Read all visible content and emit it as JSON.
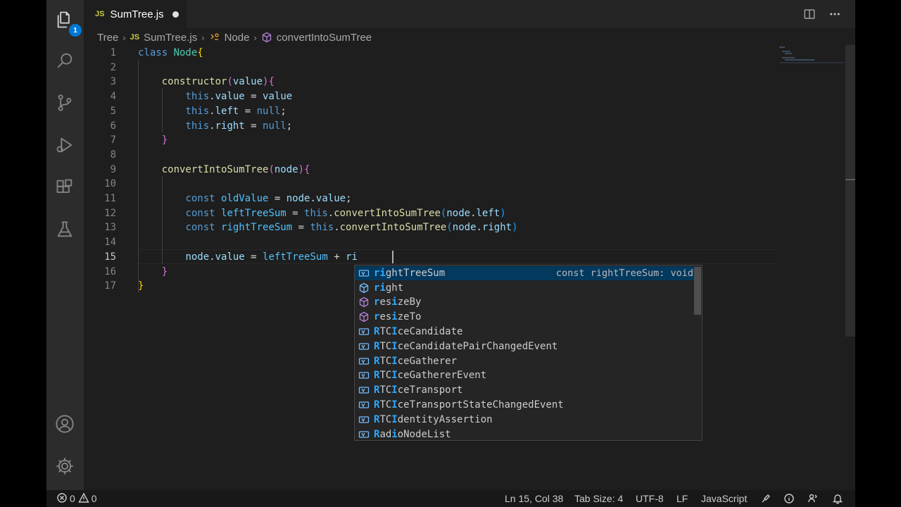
{
  "tab": {
    "title": "SumTree.js",
    "lang_badge": "JS",
    "modified": true
  },
  "breadcrumb": {
    "items": [
      "Tree",
      "SumTree.js",
      "Node",
      "convertIntoSumTree"
    ]
  },
  "activity_bar": {
    "items": [
      "explorer",
      "search",
      "source-control",
      "run-and-debug",
      "extensions",
      "testing"
    ],
    "explorer_badge": "1",
    "bottom": [
      "accounts",
      "manage"
    ]
  },
  "editor": {
    "line_numbers": [
      "1",
      "2",
      "3",
      "4",
      "5",
      "6",
      "7",
      "8",
      "9",
      "10",
      "11",
      "12",
      "13",
      "14",
      "15",
      "16",
      "17"
    ],
    "active_line": 15,
    "lines": [
      [
        {
          "t": "class ",
          "c": "kw"
        },
        {
          "t": "Node",
          "c": "cls"
        },
        {
          "t": "{",
          "c": "br1"
        }
      ],
      [],
      [
        {
          "t": "    "
        },
        {
          "t": "constructor",
          "c": "fn"
        },
        {
          "t": "(",
          "c": "br2"
        },
        {
          "t": "value",
          "c": "var"
        },
        {
          "t": ")",
          "c": "br2"
        },
        {
          "t": "{",
          "c": "br2"
        }
      ],
      [
        {
          "t": "        "
        },
        {
          "t": "this",
          "c": "kw"
        },
        {
          "t": ".",
          "c": "plain"
        },
        {
          "t": "value",
          "c": "var"
        },
        {
          "t": " = ",
          "c": "plain"
        },
        {
          "t": "value",
          "c": "var"
        }
      ],
      [
        {
          "t": "        "
        },
        {
          "t": "this",
          "c": "kw"
        },
        {
          "t": ".",
          "c": "plain"
        },
        {
          "t": "left",
          "c": "var"
        },
        {
          "t": " = ",
          "c": "plain"
        },
        {
          "t": "null",
          "c": "kw"
        },
        {
          "t": ";",
          "c": "plain"
        }
      ],
      [
        {
          "t": "        "
        },
        {
          "t": "this",
          "c": "kw"
        },
        {
          "t": ".",
          "c": "plain"
        },
        {
          "t": "right",
          "c": "var"
        },
        {
          "t": " = ",
          "c": "plain"
        },
        {
          "t": "null",
          "c": "kw"
        },
        {
          "t": ";",
          "c": "plain"
        }
      ],
      [
        {
          "t": "    "
        },
        {
          "t": "}",
          "c": "br2"
        }
      ],
      [],
      [
        {
          "t": "    "
        },
        {
          "t": "convertIntoSumTree",
          "c": "fn"
        },
        {
          "t": "(",
          "c": "br2"
        },
        {
          "t": "node",
          "c": "var"
        },
        {
          "t": ")",
          "c": "br2"
        },
        {
          "t": "{",
          "c": "br2"
        }
      ],
      [],
      [
        {
          "t": "        "
        },
        {
          "t": "const ",
          "c": "kw"
        },
        {
          "t": "oldValue",
          "c": "cst"
        },
        {
          "t": " = ",
          "c": "plain"
        },
        {
          "t": "node",
          "c": "var"
        },
        {
          "t": ".",
          "c": "plain"
        },
        {
          "t": "value",
          "c": "var"
        },
        {
          "t": ";",
          "c": "plain"
        }
      ],
      [
        {
          "t": "        "
        },
        {
          "t": "const ",
          "c": "kw"
        },
        {
          "t": "leftTreeSum",
          "c": "cst"
        },
        {
          "t": " = ",
          "c": "plain"
        },
        {
          "t": "this",
          "c": "kw"
        },
        {
          "t": ".",
          "c": "plain"
        },
        {
          "t": "convertIntoSumTree",
          "c": "fn"
        },
        {
          "t": "(",
          "c": "br3"
        },
        {
          "t": "node",
          "c": "var"
        },
        {
          "t": ".",
          "c": "plain"
        },
        {
          "t": "left",
          "c": "var"
        },
        {
          "t": ")",
          "c": "br3"
        }
      ],
      [
        {
          "t": "        "
        },
        {
          "t": "const ",
          "c": "kw"
        },
        {
          "t": "rightTreeSum",
          "c": "cst"
        },
        {
          "t": " = ",
          "c": "plain"
        },
        {
          "t": "this",
          "c": "kw"
        },
        {
          "t": ".",
          "c": "plain"
        },
        {
          "t": "convertIntoSumTree",
          "c": "fn"
        },
        {
          "t": "(",
          "c": "br3"
        },
        {
          "t": "node",
          "c": "var"
        },
        {
          "t": ".",
          "c": "plain"
        },
        {
          "t": "right",
          "c": "var"
        },
        {
          "t": ")",
          "c": "br3"
        }
      ],
      [],
      [
        {
          "t": "        "
        },
        {
          "t": "node",
          "c": "var"
        },
        {
          "t": ".",
          "c": "plain"
        },
        {
          "t": "value",
          "c": "var"
        },
        {
          "t": " = ",
          "c": "plain"
        },
        {
          "t": "leftTreeSum",
          "c": "cst"
        },
        {
          "t": " + ",
          "c": "plain"
        },
        {
          "t": "ri",
          "c": "var"
        }
      ],
      [
        {
          "t": "    "
        },
        {
          "t": "}",
          "c": "br2"
        }
      ],
      [
        {
          "t": "}",
          "c": "br1"
        }
      ]
    ]
  },
  "suggestions": [
    {
      "label": "rightTreeSum",
      "kind": "variable",
      "match": [
        0,
        1
      ],
      "detail": "const rightTreeSum: void",
      "selected": true
    },
    {
      "label": "right",
      "kind": "field",
      "match": [
        0,
        1
      ]
    },
    {
      "label": "resizeBy",
      "kind": "method",
      "match": [
        0,
        3
      ]
    },
    {
      "label": "resizeTo",
      "kind": "method",
      "match": [
        0,
        3
      ]
    },
    {
      "label": "RTCIceCandidate",
      "kind": "variable",
      "match": [
        0,
        3
      ]
    },
    {
      "label": "RTCIceCandidatePairChangedEvent",
      "kind": "variable",
      "match": [
        0,
        3
      ]
    },
    {
      "label": "RTCIceGatherer",
      "kind": "variable",
      "match": [
        0,
        3
      ]
    },
    {
      "label": "RTCIceGathererEvent",
      "kind": "variable",
      "match": [
        0,
        3
      ]
    },
    {
      "label": "RTCIceTransport",
      "kind": "variable",
      "match": [
        0,
        3
      ]
    },
    {
      "label": "RTCIceTransportStateChangedEvent",
      "kind": "variable",
      "match": [
        0,
        3
      ]
    },
    {
      "label": "RTCIdentityAssertion",
      "kind": "variable",
      "match": [
        0,
        3
      ]
    },
    {
      "label": "RadioNodeList",
      "kind": "variable",
      "match": [
        0,
        3
      ]
    }
  ],
  "status": {
    "errors": "0",
    "warnings": "0",
    "position": "Ln 15, Col 38",
    "tab_size": "Tab Size: 4",
    "encoding": "UTF-8",
    "eol": "LF",
    "language": "JavaScript"
  }
}
